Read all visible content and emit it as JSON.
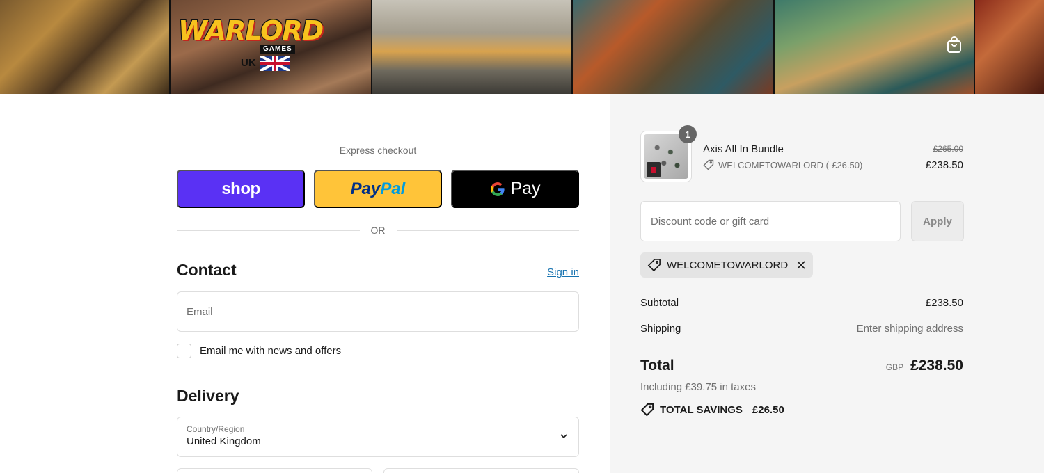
{
  "header": {
    "logo": {
      "word": "WARLORD",
      "sub": "GAMES",
      "region": "UK"
    },
    "cart_icon": "shopping-bag-icon"
  },
  "checkout": {
    "express_title": "Express checkout",
    "shop_label": "shop",
    "paypal_label_1": "Pay",
    "paypal_label_2": "Pal",
    "gpay_g": "G",
    "gpay_label": "Pay",
    "or_label": "OR",
    "contact": {
      "heading": "Contact",
      "sign_in": "Sign in",
      "email_placeholder": "Email",
      "newsletter_label": "Email me with news and offers"
    },
    "delivery": {
      "heading": "Delivery",
      "country_label": "Country/Region",
      "country_value": "United Kingdom"
    }
  },
  "summary": {
    "product": {
      "quantity": "1",
      "name": "Axis All In Bundle",
      "discount": "WELCOMETOWARLORD (-£26.50)",
      "original_price": "£265.00",
      "price": "£238.50"
    },
    "discount_placeholder": "Discount code or gift card",
    "apply_label": "Apply",
    "applied_code": "WELCOMETOWARLORD",
    "subtotal_label": "Subtotal",
    "subtotal_value": "£238.50",
    "shipping_label": "Shipping",
    "shipping_value": "Enter shipping address",
    "total_label": "Total",
    "currency": "GBP",
    "total_value": "£238.50",
    "taxes_note": "Including £39.75 in taxes",
    "savings_label": "TOTAL SAVINGS",
    "savings_value": "£26.50"
  },
  "colors": {
    "shop": "#5a31f4",
    "paypal": "#ffc439",
    "gpay": "#000000",
    "link": "#1773b0",
    "summary_bg": "#f5f5f5"
  }
}
